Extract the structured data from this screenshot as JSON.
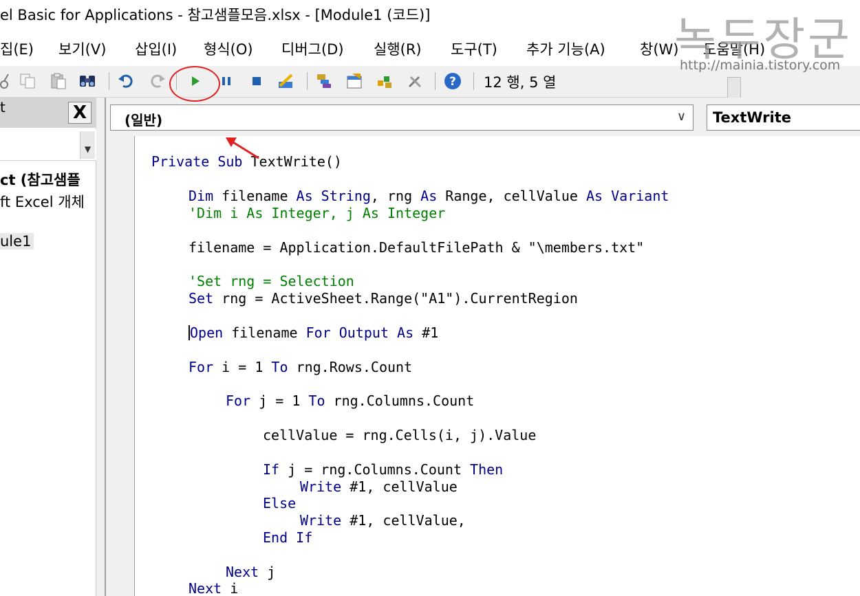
{
  "window": {
    "title": "el Basic for Applications - 참고샘플모음.xlsx - [Module1 (코드)]"
  },
  "watermark": {
    "text": "녹두장군",
    "url": "http://mainia.tistory.com"
  },
  "menu": {
    "items": [
      {
        "label": "집(E)"
      },
      {
        "label": "보기(V)"
      },
      {
        "label": "삽입(I)"
      },
      {
        "label": "형식(O)"
      },
      {
        "label": "디버그(D)"
      },
      {
        "label": "실행(R)"
      },
      {
        "label": "도구(T)"
      },
      {
        "label": "추가 기능(A)"
      },
      {
        "label": "창(W)"
      },
      {
        "label": "도움말(H)"
      }
    ]
  },
  "toolbar": {
    "status": "12 행, 5 열",
    "icons": [
      "cut-icon",
      "copy-icon",
      "paste-icon",
      "find-icon",
      "undo-icon",
      "redo-icon",
      "run-icon",
      "break-icon",
      "reset-icon",
      "design-mode-icon",
      "project-explorer-icon",
      "properties-icon",
      "object-browser-icon",
      "toolbox-icon",
      "help-icon"
    ],
    "accent": "#e02020"
  },
  "project_panel": {
    "title": "t",
    "close_label": "X",
    "tree": [
      {
        "label": "ct (참고샘플"
      },
      {
        "label": "ft Excel 개체"
      },
      {
        "label": "ule1"
      }
    ]
  },
  "code_window": {
    "object_combo": "(일반)",
    "procedure_combo": "TextWrite"
  },
  "code": {
    "colors": {
      "keyword": "#00008b",
      "comment": "#008000",
      "text": "#000000"
    },
    "lines": [
      {
        "indent": 0,
        "segments": [
          {
            "t": "Private Sub",
            "c": "kw"
          },
          {
            "t": " TextWrite()",
            "c": "tx"
          }
        ]
      },
      {
        "indent": 1,
        "segments": [
          {
            "t": "Dim",
            "c": "kw"
          },
          {
            "t": " filename ",
            "c": "tx"
          },
          {
            "t": "As String",
            "c": "kw"
          },
          {
            "t": ", rng ",
            "c": "tx"
          },
          {
            "t": "As",
            "c": "kw"
          },
          {
            "t": " Range, cellValue ",
            "c": "tx"
          },
          {
            "t": "As Variant",
            "c": "kw"
          }
        ]
      },
      {
        "indent": 1,
        "segments": [
          {
            "t": "'Dim i As Integer, j As Integer",
            "c": "cm"
          }
        ]
      },
      {
        "indent": 1,
        "segments": [
          {
            "t": "filename = Application.DefaultFilePath & \"\\members.txt\"",
            "c": "tx"
          }
        ]
      },
      {
        "indent": 1,
        "segments": [
          {
            "t": "'Set rng = Selection",
            "c": "cm"
          }
        ]
      },
      {
        "indent": 1,
        "segments": [
          {
            "t": "Set",
            "c": "kw"
          },
          {
            "t": " rng = ActiveSheet.Range(\"A1\").CurrentRegion",
            "c": "tx"
          }
        ]
      },
      {
        "indent": 1,
        "caret": true,
        "segments": [
          {
            "t": "Open",
            "c": "kw"
          },
          {
            "t": " filename ",
            "c": "tx"
          },
          {
            "t": "For Output As",
            "c": "kw"
          },
          {
            "t": " #1",
            "c": "tx"
          }
        ]
      },
      {
        "indent": 1,
        "segments": [
          {
            "t": "For",
            "c": "kw"
          },
          {
            "t": " i = 1 ",
            "c": "tx"
          },
          {
            "t": "To",
            "c": "kw"
          },
          {
            "t": " rng.Rows.Count",
            "c": "tx"
          }
        ]
      },
      {
        "indent": 2,
        "segments": [
          {
            "t": "For",
            "c": "kw"
          },
          {
            "t": " j = 1 ",
            "c": "tx"
          },
          {
            "t": "To",
            "c": "kw"
          },
          {
            "t": " rng.Columns.Count",
            "c": "tx"
          }
        ]
      },
      {
        "indent": 3,
        "segments": [
          {
            "t": "cellValue = rng.Cells(i, j).Value",
            "c": "tx"
          }
        ]
      },
      {
        "indent": 3,
        "segments": [
          {
            "t": "If",
            "c": "kw"
          },
          {
            "t": " j = rng.Columns.Count ",
            "c": "tx"
          },
          {
            "t": "Then",
            "c": "kw"
          }
        ]
      },
      {
        "indent": 4,
        "segments": [
          {
            "t": "Write",
            "c": "kw"
          },
          {
            "t": " #1, cellValue",
            "c": "tx"
          }
        ]
      },
      {
        "indent": 3,
        "segments": [
          {
            "t": "Else",
            "c": "kw"
          }
        ]
      },
      {
        "indent": 4,
        "segments": [
          {
            "t": "Write",
            "c": "kw"
          },
          {
            "t": " #1, cellValue,",
            "c": "tx"
          }
        ]
      },
      {
        "indent": 3,
        "segments": [
          {
            "t": "End If",
            "c": "kw"
          }
        ]
      },
      {
        "indent": 2,
        "segments": [
          {
            "t": "Next",
            "c": "kw"
          },
          {
            "t": " j",
            "c": "tx"
          }
        ]
      },
      {
        "indent": 1,
        "segments": [
          {
            "t": "Next",
            "c": "kw"
          },
          {
            "t": " i",
            "c": "tx"
          }
        ]
      }
    ]
  }
}
